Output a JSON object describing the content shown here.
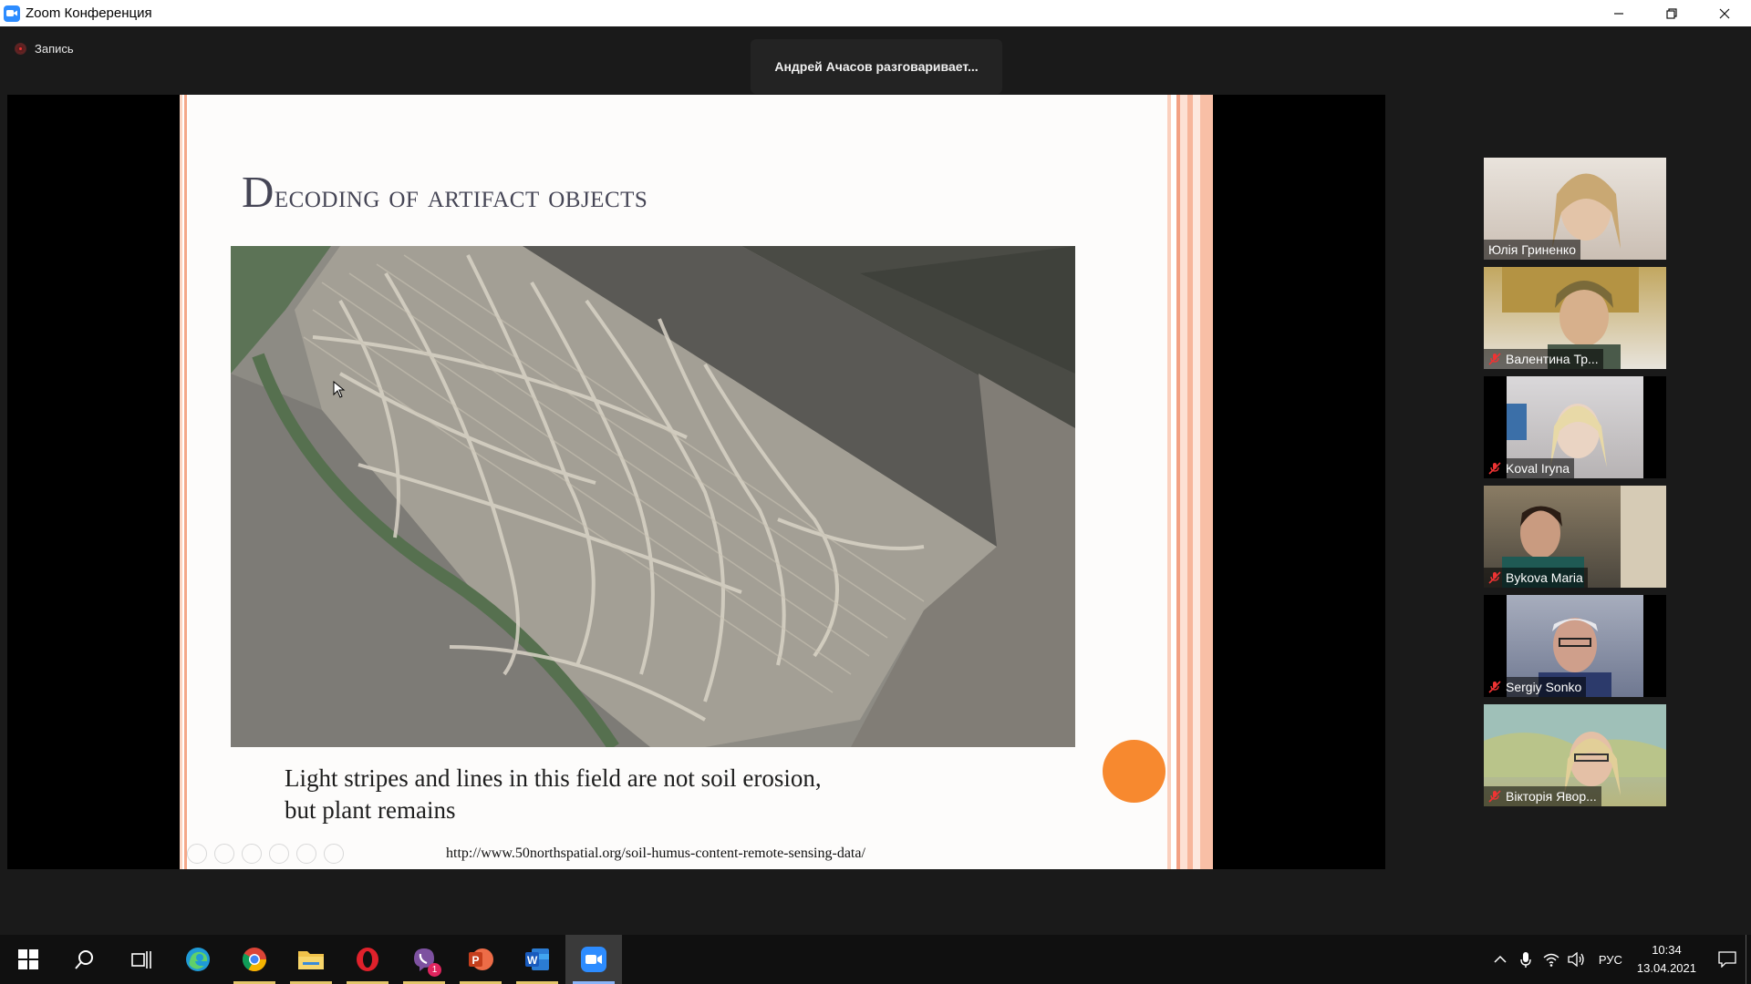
{
  "window": {
    "title": "Zoom Конференция"
  },
  "recording": {
    "label": "Запись"
  },
  "speaking_banner": "Андрей Ачасов разговаривает...",
  "slide": {
    "title_first": "D",
    "title_rest": "ecoding of artifact objects",
    "caption_line1": "Light stripes and lines in this field are not soil erosion,",
    "caption_line2": "but plant remains",
    "url": "http://www.50northspatial.org/soil-humus-content-remote-sensing-data/"
  },
  "participants": [
    {
      "name": "Юлія Гриненко",
      "muted": false,
      "bg": "#dcd2c8"
    },
    {
      "name": "Валентина Тр...",
      "muted": true,
      "bg": "#cdbb8c"
    },
    {
      "name": "Koval Iryna",
      "muted": true,
      "bg": "#c9c7c8"
    },
    {
      "name": "Bykova Maria",
      "muted": true,
      "bg": "#6e6253"
    },
    {
      "name": "Sergiy Sonko",
      "muted": true,
      "bg": "#8d97ad"
    },
    {
      "name": "Вікторія Явор...",
      "muted": true,
      "bg": "#a9b68a"
    }
  ],
  "taskbar": {
    "apps": [
      "windows-start",
      "search",
      "task-view",
      "edge",
      "chrome",
      "file-explorer",
      "opera",
      "viber",
      "powerpoint",
      "word",
      "zoom"
    ],
    "viber_badge": "1",
    "language": "РУС",
    "time": "10:34",
    "date": "13.04.2021"
  }
}
